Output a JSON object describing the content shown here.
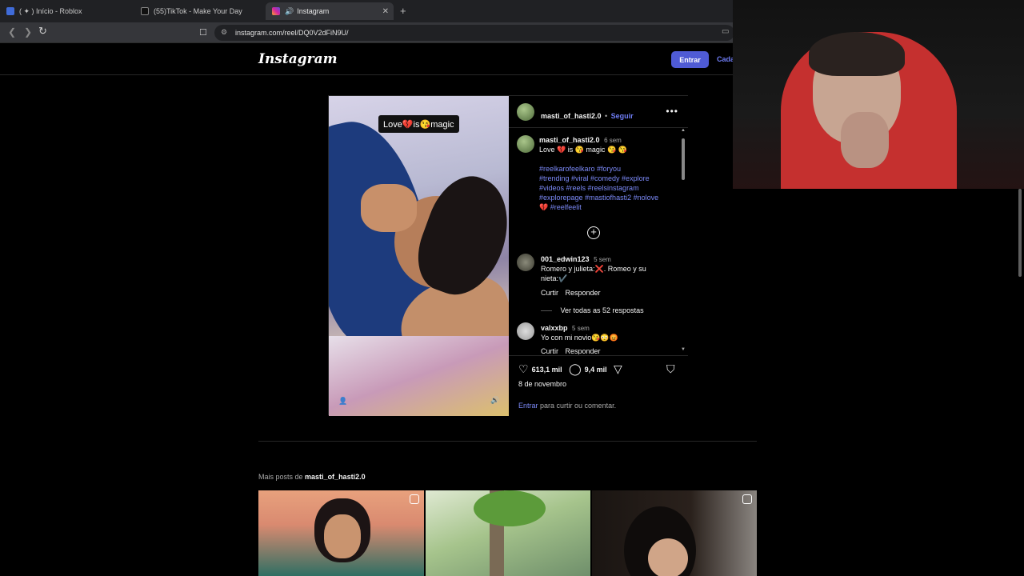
{
  "browser": {
    "tabs": [
      {
        "title": "( ✦ ) Início - Roblox",
        "color": "#3f6bd8"
      },
      {
        "title": "(55)TikTok - Make Your Day",
        "color": "#111111"
      },
      {
        "title": "Instagram",
        "color": "#d6249f"
      }
    ],
    "url": "instagram.com/reel/DQ0V2dFiN9U/"
  },
  "header": {
    "logo": "Instagram",
    "login_label": "Entrar",
    "signup_label": "Cada"
  },
  "post": {
    "overlay_text": "Love💔is😘magic",
    "author": "masti_of_hasti2.0",
    "follow": "• Seguir",
    "caption": {
      "author": "masti_of_hasti2.0",
      "time": "6 sem",
      "text": "Love 💔 is 😘 magic 😘 😘",
      "hashtag_lines": [
        "#reelkarofeelkaro #foryou",
        "#trending #viral #comedy #explore",
        "#videos #reels #reelsinstagram",
        "#explorepage #mastiofhasti2 #nolove",
        "💔 #reelfeelit"
      ]
    },
    "comments": [
      {
        "user": "001_edwin123",
        "time": "5 sem",
        "lines": [
          "Romero y julieta:❌. Romeo y su",
          "nieta:✔️"
        ],
        "like": "Curtir",
        "reply": "Responder",
        "view_replies": "Ver todas as 52 respostas"
      },
      {
        "user": "valxxbp",
        "time": "5 sem",
        "lines": [
          "Yo con mi novio😘😳😡"
        ],
        "like": "Curtir",
        "reply": "Responder"
      }
    ],
    "likes": "613,1 mil",
    "comments_count": "9,4 mil",
    "date": "8 de novembro",
    "login_prompt_link": "Entrar",
    "login_prompt_text": "para curtir ou comentar."
  },
  "more_posts": {
    "label": "Mais posts de",
    "user": "masti_of_hasti2.0"
  },
  "icons": [
    "back-icon",
    "forward-icon",
    "reload-icon",
    "bookmark-icon",
    "site-info-icon",
    "cast-icon",
    "heart-icon",
    "comment-icon",
    "share-icon",
    "save-icon",
    "more-icon",
    "add-comment-icon",
    "reel-icon",
    "mute-icon",
    "user-tag-icon"
  ]
}
